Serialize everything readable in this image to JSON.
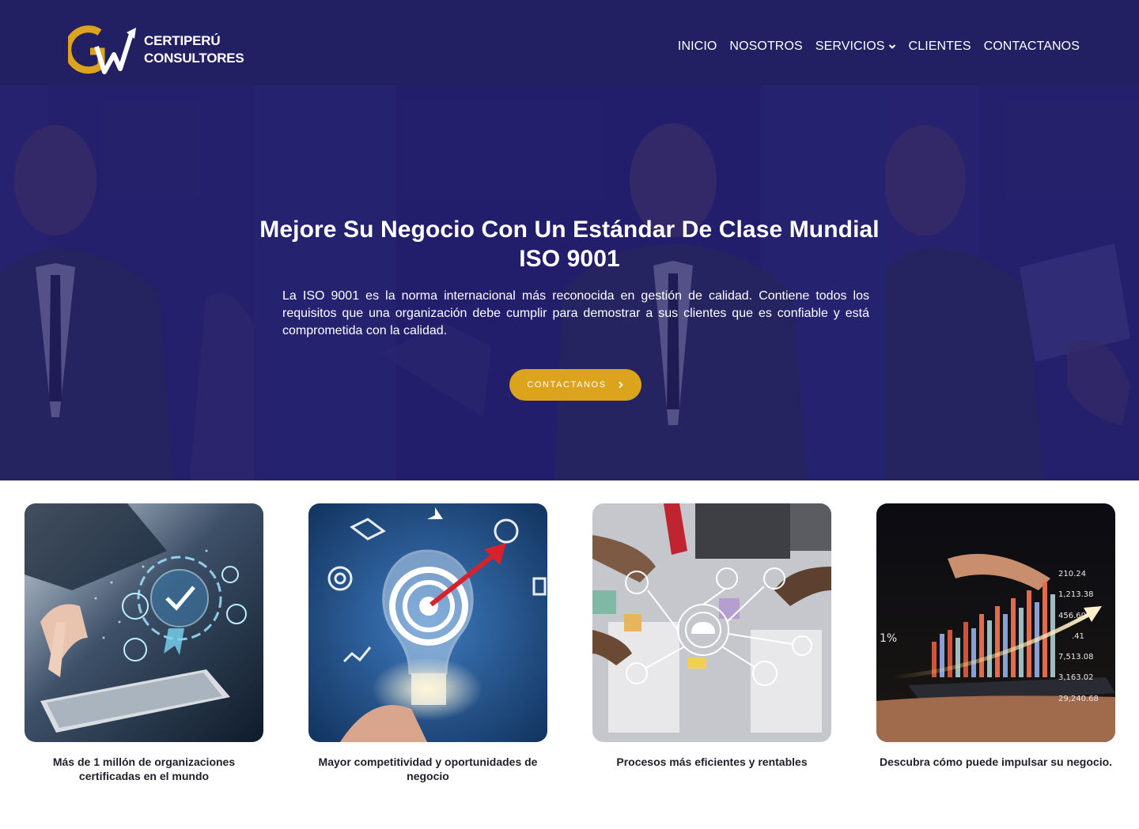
{
  "brand": {
    "line1": "CERTIPERÚ",
    "line2": "CONSULTORES",
    "logo_icon": "gw-growth-arrow-logo",
    "colors": {
      "navy": "#221f63",
      "gold": "#dca41c"
    }
  },
  "nav": {
    "items": [
      {
        "label": "INICIO"
      },
      {
        "label": "NOSOTROS"
      },
      {
        "label": "SERVICIOS",
        "icon": "chevron-down-icon"
      },
      {
        "label": "CLIENTES"
      },
      {
        "label": "CONTACTANOS"
      }
    ]
  },
  "hero": {
    "title_line1": "Mejore Su Negocio Con Un Estándar De Clase Mundial",
    "title_line2": "ISO 9001",
    "text": "La ISO 9001 es la norma internacional más reconocida en gestión de calidad. Contiene todos los requisitos que una organización debe cumplir para demostrar a sus clientes que es confiable y está comprometida con la calidad.",
    "button_label": "CONTACTANOS",
    "button_icon": "chevron-right-icon"
  },
  "features": [
    {
      "caption": "Más de 1 millón de organizaciones certificadas en el mundo",
      "image": "certification-gear-tablet-image"
    },
    {
      "caption": "Mayor competitividad y oportunidades de negocio",
      "image": "lightbulb-target-image"
    },
    {
      "caption": "Procesos más eficientes y rentables",
      "image": "process-network-image"
    },
    {
      "caption": "Descubra cómo puede impulsar su negocio.",
      "image": "growth-chart-tablet-image"
    }
  ],
  "card_numbers": [
    "210.24",
    "1,213.38",
    "456.60",
    ".41",
    "7,513.08",
    "3,163.02",
    "29,240.68",
    "1%"
  ]
}
